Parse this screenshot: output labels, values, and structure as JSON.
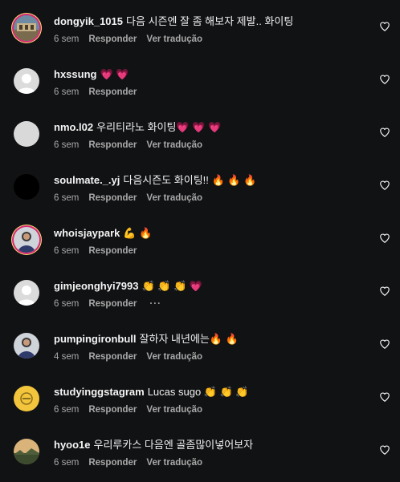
{
  "labels": {
    "reply": "Responder",
    "translate": "Ver tradução"
  },
  "colors": {
    "background": "#111214",
    "meta_text": "#a8a8a8",
    "ring": "#d62976"
  },
  "comments": [
    {
      "username": "dongyik_1015",
      "text": "다음 시즌엔 잘 좀 해보자 제발.. 화이팅",
      "time": "6 sem",
      "has_translate": true,
      "avatar_icon": "landscape-photo-avatar",
      "story_ring": true
    },
    {
      "username": "hxssung",
      "text": "💗 💗",
      "time": "6 sem",
      "has_translate": false,
      "avatar_icon": "default-user-avatar",
      "story_ring": false
    },
    {
      "username": "nmo.l02",
      "text": "우리티라노 화이팅💗 💗 💗",
      "time": "6 sem",
      "has_translate": true,
      "avatar_icon": "gray-avatar",
      "story_ring": false
    },
    {
      "username": "soulmate._.yj",
      "text": "다음시즌도 화이팅!! 🔥 🔥 🔥",
      "time": "6 sem",
      "has_translate": true,
      "avatar_icon": "black-avatar",
      "story_ring": false
    },
    {
      "username": "whoisjaypark",
      "text": "💪 🔥",
      "time": "6 sem",
      "has_translate": false,
      "avatar_icon": "person-photo-avatar",
      "story_ring": true
    },
    {
      "username": "gimjeonghyi7993",
      "text": "👏 👏 👏 💗",
      "time": "6 sem",
      "has_translate": false,
      "has_more": true,
      "more_label": "···",
      "avatar_icon": "default-user-avatar",
      "story_ring": false
    },
    {
      "username": "pumpingironbull",
      "text": "잘하자 내년에는🔥 🔥",
      "time": "4 sem",
      "has_translate": true,
      "avatar_icon": "person-photo-avatar",
      "story_ring": false
    },
    {
      "username": "studyinggstagram",
      "text": "Lucas sugo 👏 👏 👏",
      "time": "6 sem",
      "has_translate": true,
      "avatar_icon": "yellow-logo-avatar",
      "story_ring": false
    },
    {
      "username": "hyoo1e",
      "text": "우리루카스 다음엔 골좀많이넣어보자",
      "time": "6 sem",
      "has_translate": true,
      "avatar_icon": "sunset-photo-avatar",
      "story_ring": false
    }
  ]
}
